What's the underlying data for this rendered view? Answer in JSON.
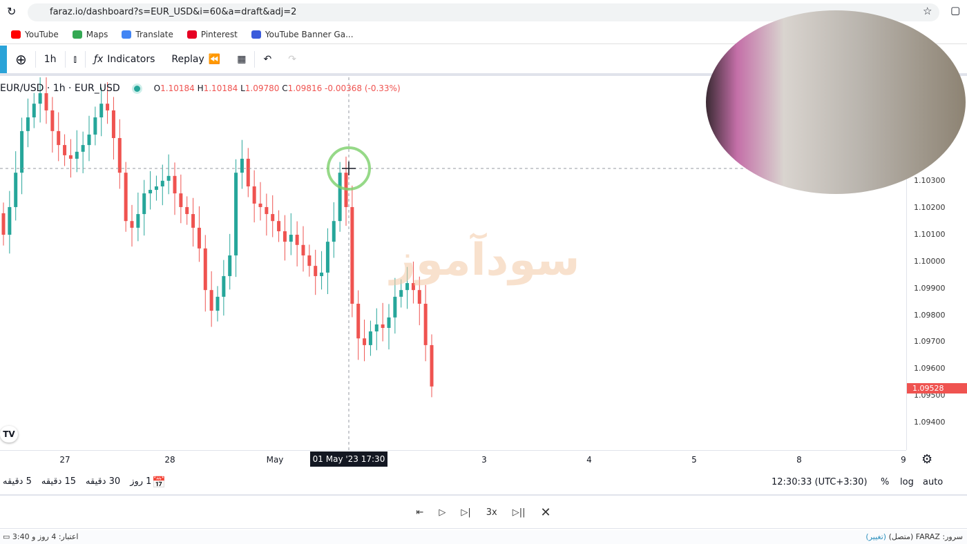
{
  "browser": {
    "url": "faraz.io/dashboard?s=EUR_USD&i=60&a=draft&adj=2",
    "bookmarks": [
      {
        "label": "YouTube",
        "icon": "youtube-icon",
        "color": "#ff0000"
      },
      {
        "label": "Maps",
        "icon": "maps-icon",
        "color": "#34a853"
      },
      {
        "label": "Translate",
        "icon": "translate-icon",
        "color": "#4285f4"
      },
      {
        "label": "Pinterest",
        "icon": "pinterest-icon",
        "color": "#e60023"
      },
      {
        "label": "YouTube Banner Ga...",
        "icon": "wix-icon",
        "color": "#3b5bdb"
      }
    ]
  },
  "toolbar": {
    "interval": "1h",
    "indicators": "Indicators",
    "replay": "Replay"
  },
  "legend": {
    "symbol": "EUR/USD · 1h · EUR_USD",
    "o_label": "O",
    "o": "1.10184",
    "h_label": "H",
    "h": "1.10184",
    "l_label": "L",
    "l": "1.09780",
    "c_label": "C",
    "c": "1.09816",
    "change": "-0.00368 (-0.33%)"
  },
  "watermark": "سودآموز",
  "chart_data": {
    "type": "candlestick",
    "up_color": "#26a69a",
    "down_color": "#ef5350",
    "closes": [
      1.10102,
      1.10205,
      1.10333,
      1.10488,
      1.10539,
      1.1059,
      1.10629,
      1.10565,
      1.10488,
      1.10436,
      1.10398,
      1.10385,
      1.10411,
      1.10436,
      1.10475,
      1.10539,
      1.1059,
      1.10565,
      1.10462,
      1.10333,
      1.10153,
      1.10128,
      1.10179,
      1.10256,
      1.10269,
      1.10282,
      1.10303,
      1.10321,
      1.10256,
      1.10205,
      1.10179,
      1.10128,
      1.10051,
      1.09896,
      1.09819,
      1.09871,
      1.09948,
      1.10025,
      1.10333,
      1.10385,
      1.10282,
      1.10218,
      1.10205,
      1.10179,
      1.10153,
      1.10115,
      1.10076,
      1.10102,
      1.10064,
      1.10025,
      1.09986,
      1.09948,
      1.09961,
      1.10076,
      1.10153,
      1.10333,
      1.10205,
      1.09845,
      1.09716,
      1.09691,
      1.09742,
      1.09768,
      1.09755,
      1.09794,
      1.09871,
      1.09896,
      1.09922,
      1.09896,
      1.09845,
      1.09691,
      1.09537
    ],
    "ylim": [
      1.0935,
      1.1077
    ],
    "y_ticks": [
      "1.10300",
      "1.10200",
      "1.10100",
      "1.10000",
      "1.09900",
      "1.09800",
      "1.09700",
      "1.09600",
      "1.09500",
      "1.09400"
    ],
    "x_ticks": [
      "27",
      "28",
      "May",
      "3",
      "4",
      "5",
      "8",
      "9"
    ],
    "last_price": "1.09528",
    "crosshair_time": "01 May '23   17:30"
  },
  "bottom": {
    "timeframes": [
      "5 دقیقه",
      "15 دقیقه",
      "30 دقیقه",
      "1 روز"
    ],
    "clock": "12:30:33 (UTC+3:30)",
    "percent": "%",
    "log": "log",
    "auto": "auto"
  },
  "replay": {
    "speed": "3x"
  },
  "status": {
    "credit": "اعتبار: 4 روز و 3:40",
    "server": "سرور: FARAZ (متصل)",
    "change": "(تغییر)"
  }
}
